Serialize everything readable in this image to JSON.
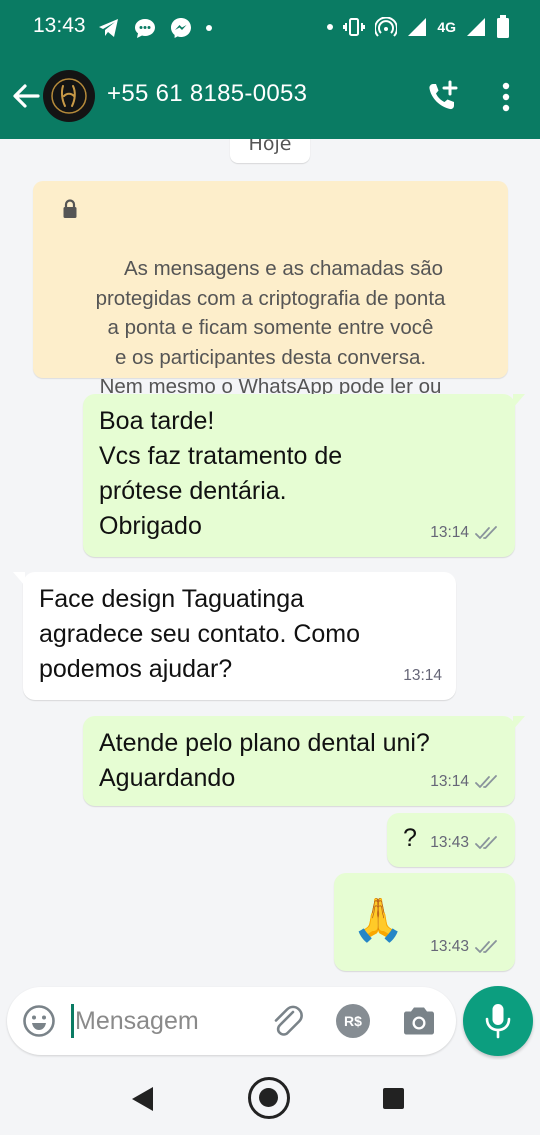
{
  "status_bar": {
    "time": "13:43",
    "network": "4G",
    "left_icons": [
      "telegram-icon",
      "chat-icon",
      "messenger-icon",
      "dot"
    ],
    "right_icons": [
      "dot",
      "vibrate-icon",
      "hotspot-icon",
      "signal-icon",
      "signal-icon",
      "battery-icon"
    ]
  },
  "header": {
    "contact": "+55 61 8185-0053",
    "accent_color": "#0a7b63"
  },
  "chat": {
    "date_chip": "Hoje",
    "encryption_notice": "As mensagens e as chamadas são\nprotegidas com a criptografia de ponta\na ponta e ficam somente entre você\ne os participantes desta conversa.\nNem mesmo o WhatsApp pode ler ou\nouvi-las. Toque para saber mais.",
    "messages": [
      {
        "direction": "out",
        "text": "Boa tarde!\nVcs faz tratamento de\nprótese dentária.\nObrigado",
        "time": "13:14",
        "status": "double-check-icon"
      },
      {
        "direction": "in",
        "text": "Face design Taguatinga\nagradece seu contato. Como\npodemos ajudar?",
        "time": "13:14"
      },
      {
        "direction": "out",
        "text": "Atende pelo plano dental uni?\nAguardando",
        "time": "13:14",
        "status": "double-check-icon"
      },
      {
        "direction": "out",
        "text": "?",
        "time": "13:43",
        "status": "double-check-icon"
      },
      {
        "direction": "out",
        "text": "🙏",
        "time": "13:43",
        "status": "double-check-icon"
      }
    ]
  },
  "composer": {
    "placeholder": "Mensagem",
    "value": "",
    "pay_label": "R$"
  }
}
